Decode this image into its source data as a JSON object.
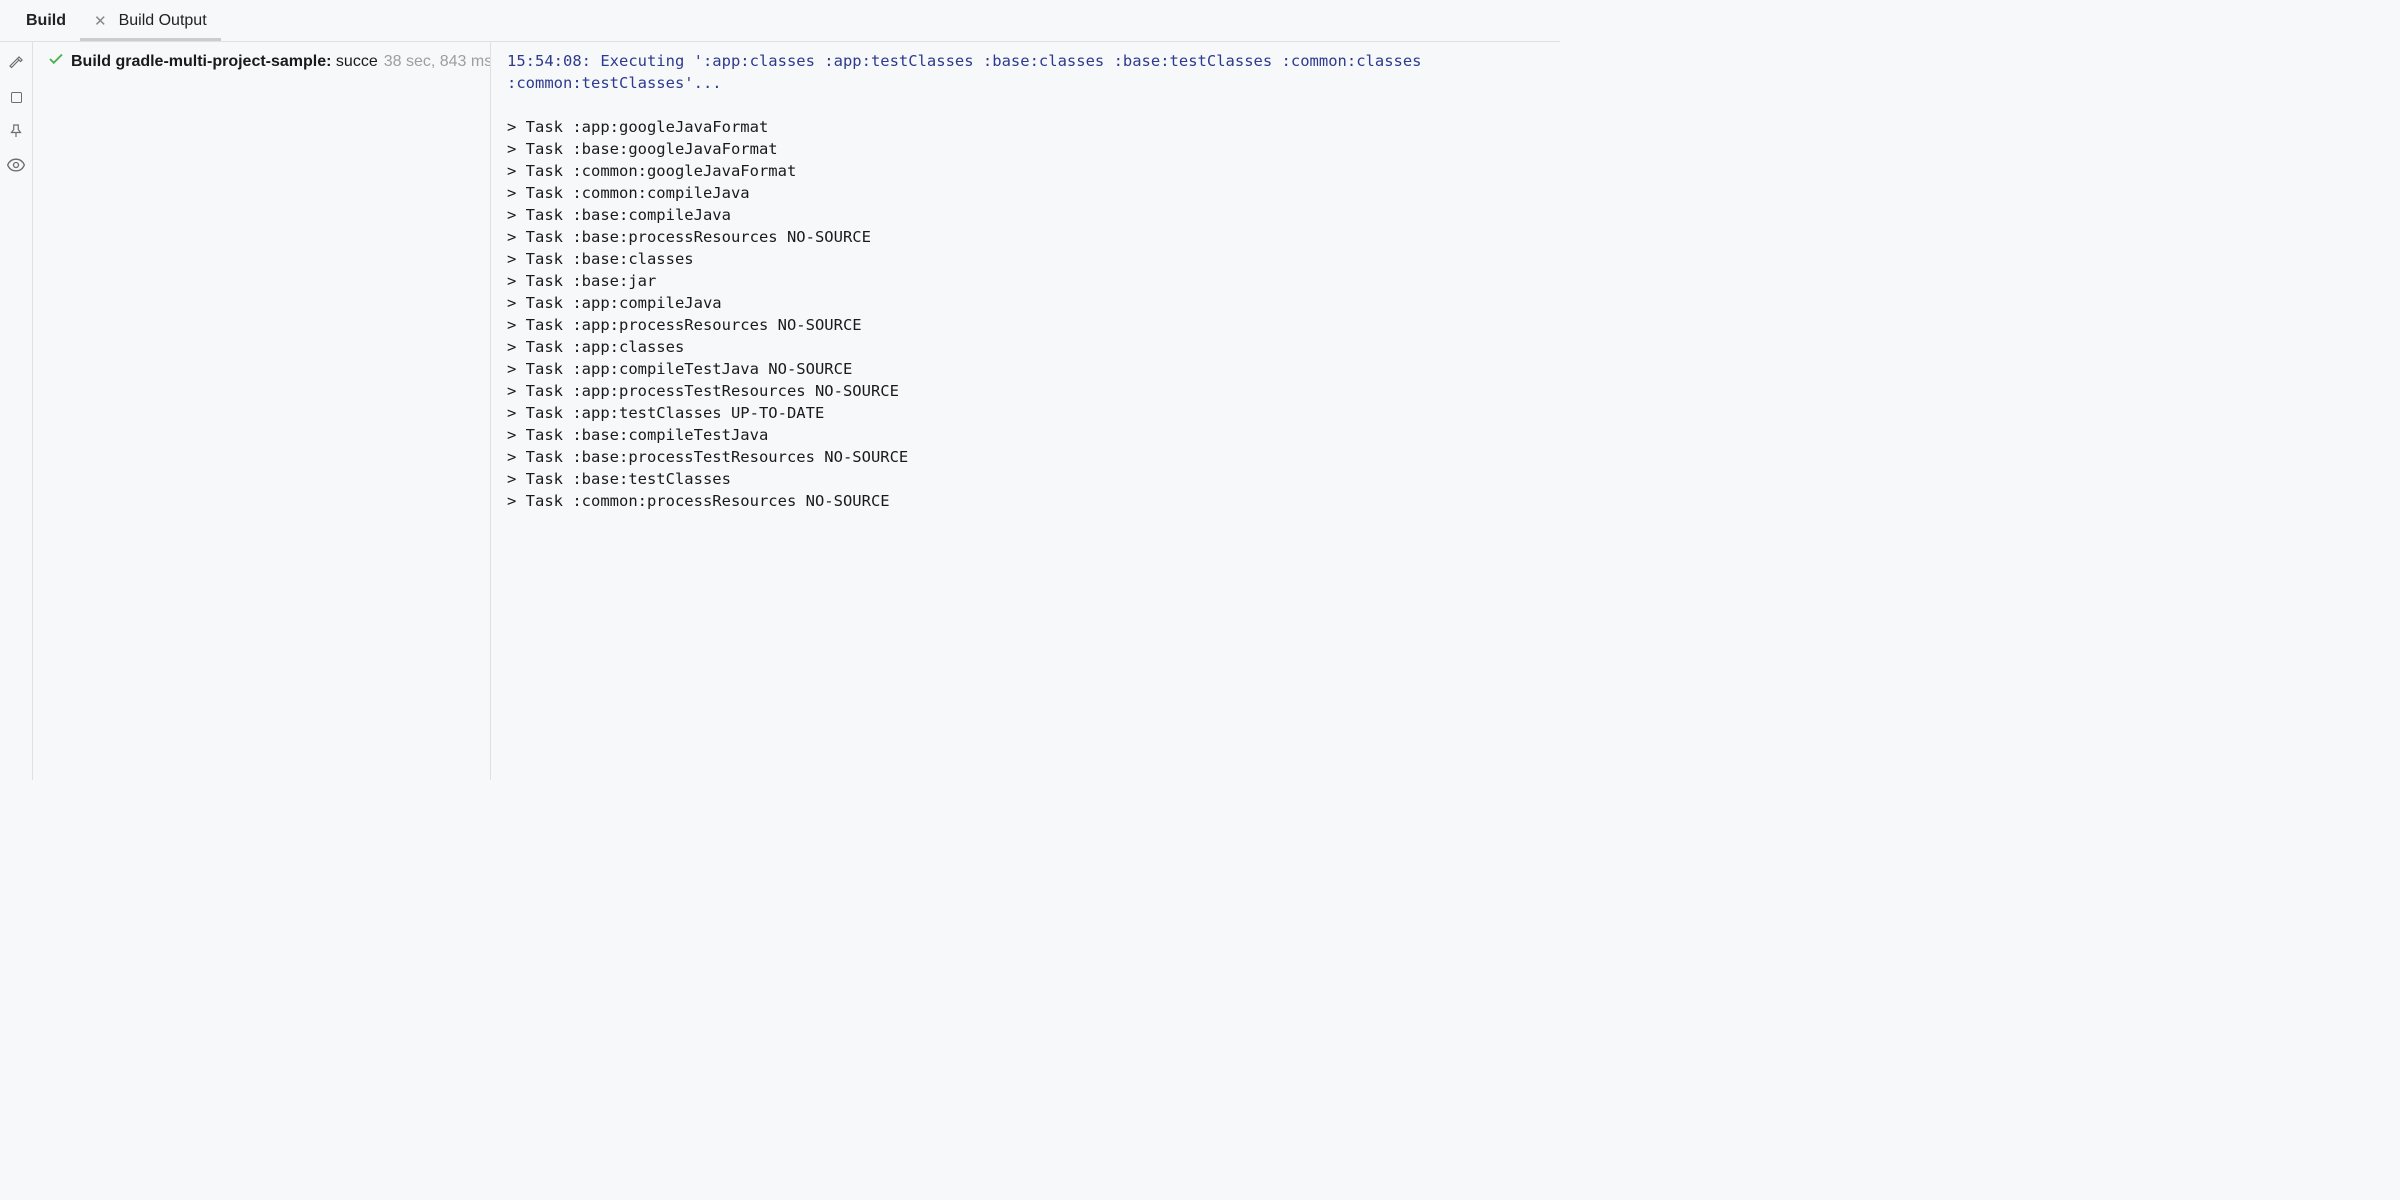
{
  "tabs": {
    "primary": "Build",
    "output": "Build Output"
  },
  "tree": {
    "label_prefix": "Build ",
    "project": "gradle-multi-project-sample:",
    "status": " succe",
    "time": "38 sec, 843 ms"
  },
  "output": {
    "header": "15:54:08: Executing ':app:classes :app:testClasses :base:classes :base:testClasses :common:classes :common:testClasses'...",
    "tasks": [
      "> Task :app:googleJavaFormat",
      "> Task :base:googleJavaFormat",
      "> Task :common:googleJavaFormat",
      "> Task :common:compileJava",
      "> Task :base:compileJava",
      "> Task :base:processResources NO-SOURCE",
      "> Task :base:classes",
      "> Task :base:jar",
      "> Task :app:compileJava",
      "> Task :app:processResources NO-SOURCE",
      "> Task :app:classes",
      "> Task :app:compileTestJava NO-SOURCE",
      "> Task :app:processTestResources NO-SOURCE",
      "> Task :app:testClasses UP-TO-DATE",
      "> Task :base:compileTestJava",
      "> Task :base:processTestResources NO-SOURCE",
      "> Task :base:testClasses",
      "> Task :common:processResources NO-SOURCE"
    ]
  }
}
